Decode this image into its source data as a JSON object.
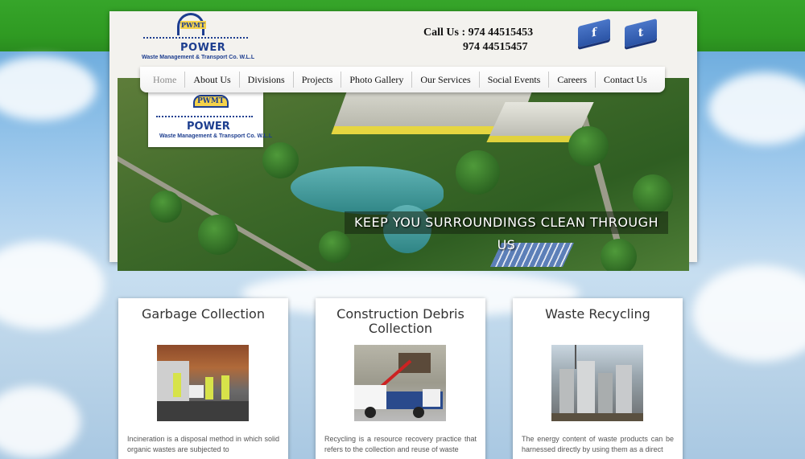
{
  "brand": {
    "emblem": "PWMT",
    "name": "POWER",
    "subtitle": "Waste Management & Transport Co. W.L.L"
  },
  "contact": {
    "label": "Call Us : 974 44515453",
    "second_number": "974 44515457"
  },
  "social": {
    "facebook_glyph": "f",
    "twitter_glyph": "t"
  },
  "nav": {
    "items": [
      {
        "label": "Home"
      },
      {
        "label": "About Us"
      },
      {
        "label": "Divisions"
      },
      {
        "label": "Projects"
      },
      {
        "label": "Photo Gallery"
      },
      {
        "label": "Our Services"
      },
      {
        "label": "Social Events"
      },
      {
        "label": "Careers"
      },
      {
        "label": "Contact Us"
      }
    ]
  },
  "banner": {
    "caption": "Keep you surroundings clean through us"
  },
  "services": [
    {
      "title": "Garbage Collection",
      "text": "Incineration is a disposal method in which solid organic wastes are subjected to"
    },
    {
      "title": "Construction Debris Collection",
      "text": "Recycling is a resource recovery practice that refers to the collection and reuse of waste"
    },
    {
      "title": "Waste Recycling",
      "text": "The energy content of waste products can be harnessed directly by using them as a direct"
    }
  ],
  "colors": {
    "green_band": "#36a52a",
    "brand_blue": "#1d3e8f",
    "brand_yellow": "#f4d24a"
  }
}
